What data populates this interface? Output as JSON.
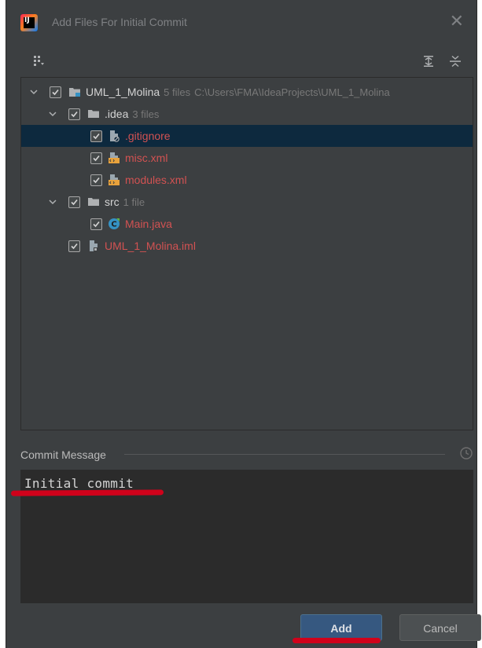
{
  "window": {
    "title": "Add Files For Initial Commit",
    "close_glyph": "✕",
    "app_icon": "intellij-idea-icon",
    "app_icon_text": "IJ"
  },
  "toolbar": {
    "group_by_icon": "group-by-icon",
    "expand_all_icon": "expand-all-icon",
    "collapse_all_icon": "collapse-all-icon"
  },
  "tree": {
    "root": {
      "name": "UML_1_Molina",
      "meta": "5 files",
      "path": "C:\\Users\\FMA\\IdeaProjects\\UML_1_Molina",
      "checked": true
    },
    "idea_dir": {
      "name": ".idea",
      "meta": "3 files",
      "checked": true
    },
    "files_idea": [
      {
        "name": ".gitignore",
        "icon": "gitignore-file-icon",
        "checked": true,
        "selected": true
      },
      {
        "name": "misc.xml",
        "icon": "xml-file-icon",
        "checked": true
      },
      {
        "name": "modules.xml",
        "icon": "xml-file-icon",
        "checked": true
      }
    ],
    "src_dir": {
      "name": "src",
      "meta": "1 file",
      "checked": true
    },
    "files_src": [
      {
        "name": "Main.java",
        "icon": "java-class-icon",
        "checked": true
      }
    ],
    "iml_file": {
      "name": "UML_1_Molina.iml",
      "icon": "iml-file-icon",
      "checked": true
    }
  },
  "commit": {
    "label": "Commit Message",
    "message": "Initial commit",
    "history_icon": "history-icon"
  },
  "buttons": {
    "add": "Add",
    "cancel": "Cancel"
  },
  "colors": {
    "dialog_bg": "#3c3f41",
    "selection_bg": "#0d293e",
    "new_file_red": "#d25252",
    "primary_button": "#365880",
    "annotation_red": "#d0021b"
  }
}
